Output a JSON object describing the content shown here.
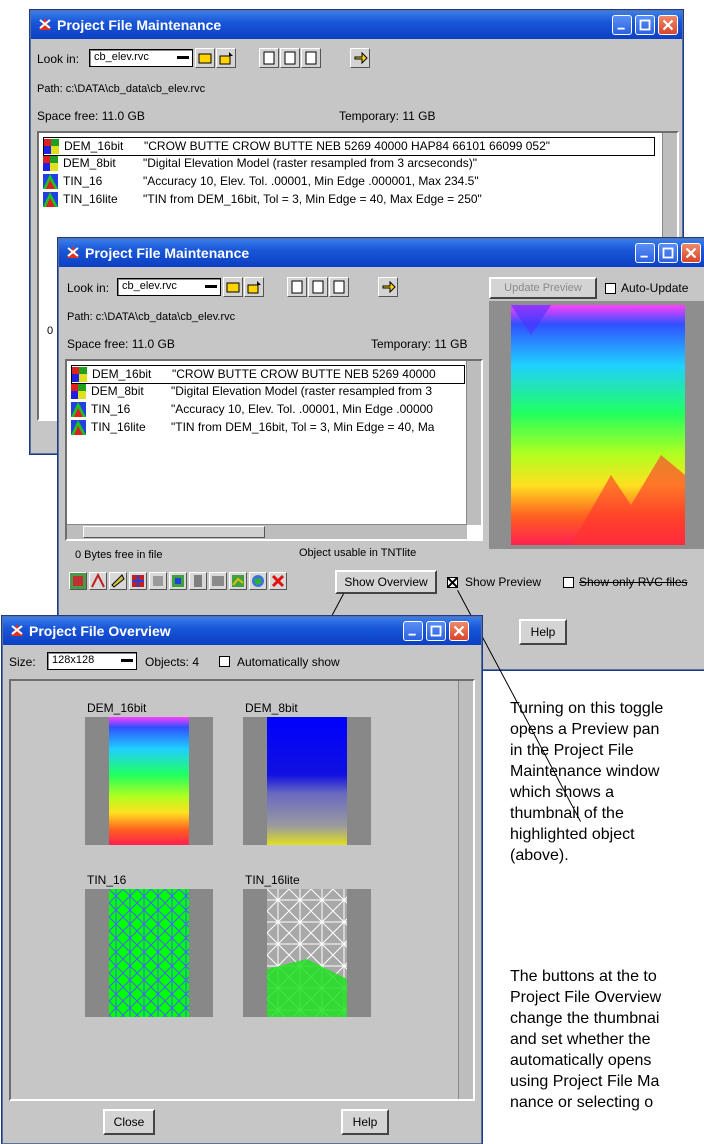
{
  "win1": {
    "title": "Project File Maintenance",
    "look_in_label": "Look in:",
    "look_in_value": "cb_elev.rvc",
    "path": "Path: c:\\DATA\\cb_data\\cb_elev.rvc",
    "space_free": "Space free:  11.0 GB",
    "temporary": "Temporary: 11 GB",
    "objects": [
      {
        "name": "DEM_16bit",
        "desc": "\"CROW BUTTE CROW BUTTE NEB 5269  40000 HAP84 66101 66099 052\""
      },
      {
        "name": "DEM_8bit",
        "desc": "\"Digital Elevation Model (raster resampled from 3 arcseconds)\""
      },
      {
        "name": "TIN_16",
        "desc": "\"Accuracy 10, Elev. Tol. .00001, Min Edge .000001, Max 234.5\""
      },
      {
        "name": "TIN_16lite",
        "desc": "\"TIN from DEM_16bit, Tol = 3, Min Edge = 40, Max Edge = 250\""
      }
    ],
    "partial_status": "0"
  },
  "win2": {
    "title": "Project File Maintenance",
    "look_in_label": "Look in:",
    "look_in_value": "cb_elev.rvc",
    "path": "Path: c:\\DATA\\cb_data\\cb_elev.rvc",
    "space_free": "Space free:  11.0 GB",
    "temporary": "Temporary: 11 GB",
    "objects": [
      {
        "name": "DEM_16bit",
        "desc": "\"CROW BUTTE CROW BUTTE NEB 5269  40000"
      },
      {
        "name": "DEM_8bit",
        "desc": "\"Digital Elevation Model (raster resampled from 3"
      },
      {
        "name": "TIN_16",
        "desc": "\"Accuracy 10, Elev. Tol. .00001, Min Edge .00000"
      },
      {
        "name": "TIN_16lite",
        "desc": "\"TIN from DEM_16bit, Tol = 3, Min Edge = 40, Ma"
      }
    ],
    "bytes_free": "0 Bytes free in file",
    "usable": "Object usable in TNTlite",
    "update_preview": "Update Preview",
    "auto_update": "Auto-Update",
    "show_overview": "Show Overview",
    "show_preview": "Show Preview",
    "show_only_rvc": "Show only RVC files",
    "help": "Help"
  },
  "win3": {
    "title": "Project File Overview",
    "size_label": "Size:",
    "size_value": "128x128",
    "objects_count": "Objects: 4",
    "auto_show": "Automatically show",
    "thumbs": [
      "DEM_16bit",
      "DEM_8bit",
      "TIN_16",
      "TIN_16lite"
    ],
    "close": "Close",
    "help": "Help"
  },
  "callouts": {
    "preview_lines": [
      "Turning on this toggle",
      "opens a Preview pan",
      "in the Project File",
      "Maintenance window",
      "which shows a",
      "thumbnail of the",
      "highlighted object",
      "(above)."
    ],
    "overview_lines": [
      "The buttons at the to",
      "Project File Overview",
      "change the thumbnai",
      "and set whether the",
      "automatically opens",
      "using Project File Ma",
      "nance or selecting o"
    ]
  },
  "colors": {
    "titlebar": "#1956d8",
    "window_bg": "#c6c6c6",
    "close_button": "#d8452a"
  }
}
